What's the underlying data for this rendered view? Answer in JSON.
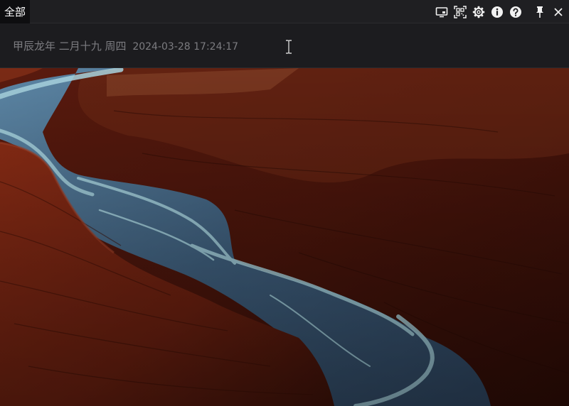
{
  "titlebar": {
    "tab_label": "全部",
    "tools": [
      {
        "name": "screen-icon"
      },
      {
        "name": "qr-scan-icon"
      },
      {
        "name": "gear-icon"
      },
      {
        "name": "info-icon"
      },
      {
        "name": "help-icon"
      },
      {
        "name": "pin-icon"
      },
      {
        "name": "close-icon"
      }
    ]
  },
  "input": {
    "lunar_date": "甲辰龙年 二月十九 周四",
    "datetime": "2024-03-28 17:24:17"
  },
  "colors": {
    "background": "#1c1c1f",
    "titlebar": "#1f1f22",
    "tab_active": "#0e0e10",
    "date_text": "#7c7c80",
    "canyon_rock": "#6b2313",
    "river": "#6f9fb8"
  }
}
